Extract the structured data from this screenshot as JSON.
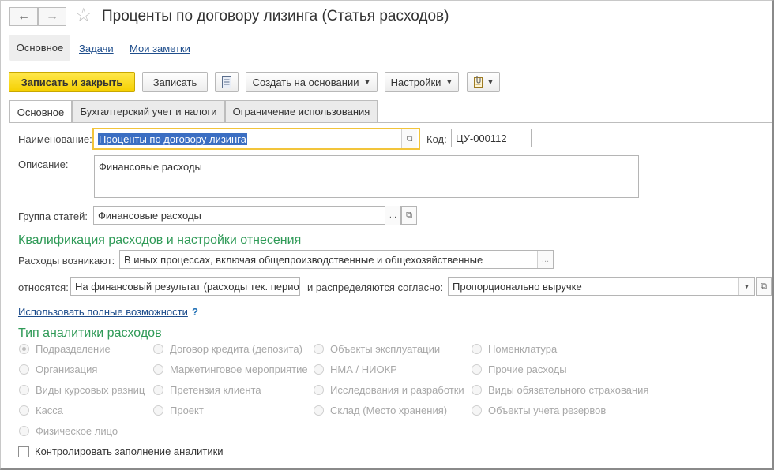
{
  "window": {
    "title": "Проценты по договору лизинга (Статья расходов)"
  },
  "top_nav": {
    "items": [
      {
        "label": "Основное",
        "active": true
      },
      {
        "label": "Задачи",
        "active": false
      },
      {
        "label": "Мои заметки",
        "active": false
      }
    ]
  },
  "toolbar": {
    "save_close": "Записать и закрыть",
    "save": "Записать",
    "create_based_on": "Создать на основании",
    "settings": "Настройки"
  },
  "tabs": [
    {
      "label": "Основное",
      "active": true
    },
    {
      "label": "Бухгалтерский учет и налоги",
      "active": false
    },
    {
      "label": "Ограничение использования",
      "active": false
    }
  ],
  "form": {
    "name_label": "Наименование:",
    "name_value": "Проценты по договору лизинга",
    "code_label": "Код:",
    "code_value": "ЦУ-000112",
    "description_label": "Описание:",
    "description_value": "Финансовые расходы",
    "group_label": "Группа статей:",
    "group_value": "Финансовые расходы"
  },
  "qualification": {
    "title": "Квалификация расходов и настройки отнесения",
    "arise_label": "Расходы возникают:",
    "arise_value": "В иных процессах, включая общепроизводственные и общехозяйственные",
    "relate_label": "относятся:",
    "relate_value": "На финансовый результат (расходы тек. перио,",
    "distribute_label": "и распределяются согласно:",
    "distribute_value": "Пропорционально выручке",
    "full_features_link": "Использовать полные возможности",
    "help": "?"
  },
  "analytics": {
    "title": "Тип аналитики расходов",
    "columns": [
      [
        "Подразделение",
        "Организация",
        "Виды курсовых разниц",
        "Касса",
        "Физическое лицо"
      ],
      [
        "Договор кредита (депозита)",
        "Маркетинговое мероприятие",
        "Претензия клиента",
        "Проект"
      ],
      [
        "Объекты эксплуатации",
        "НМА / НИОКР",
        "Исследования и разработки",
        "Склад (Место хранения)"
      ],
      [
        "Номенклатура",
        "Прочие расходы",
        "Виды обязательного страхования",
        "Объекты учета резервов"
      ]
    ],
    "selected": "Подразделение",
    "control_checkbox_label": "Контролировать заполнение аналитики",
    "control_checked": false
  },
  "colors": {
    "primary_button": "#f5d000",
    "section_title": "#2f9a57",
    "link": "#1f4e8c",
    "focus_border": "#f2c43a"
  }
}
